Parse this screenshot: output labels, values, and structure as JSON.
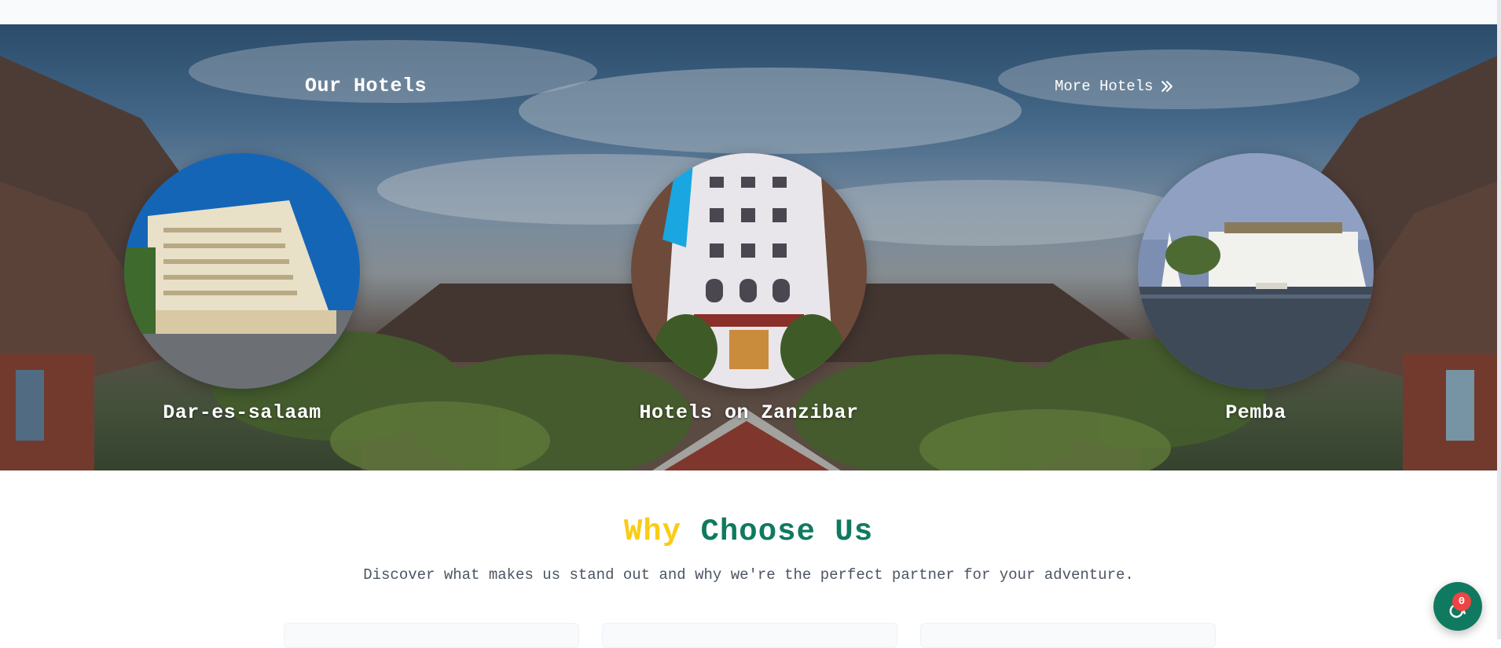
{
  "hotels_section": {
    "title": "Our Hotels",
    "more_link": "More Hotels",
    "hotels": [
      {
        "name": "Dar-es-salaam"
      },
      {
        "name": "Hotels on Zanzibar"
      },
      {
        "name": "Pemba"
      }
    ]
  },
  "why_section": {
    "heading_word_1": "Why",
    "heading_word_2": "Choose Us",
    "subtitle": "Discover what makes us stand out and why we're the perfect partner for your adventure."
  },
  "cart": {
    "count": "0"
  },
  "colors": {
    "brand_green": "#0f7a5f",
    "accent_yellow": "#facc15",
    "badge_red": "#ef4444"
  },
  "icons": {
    "more_link": "double-chevron-right-icon",
    "floating_button": "accessibility-icon"
  }
}
